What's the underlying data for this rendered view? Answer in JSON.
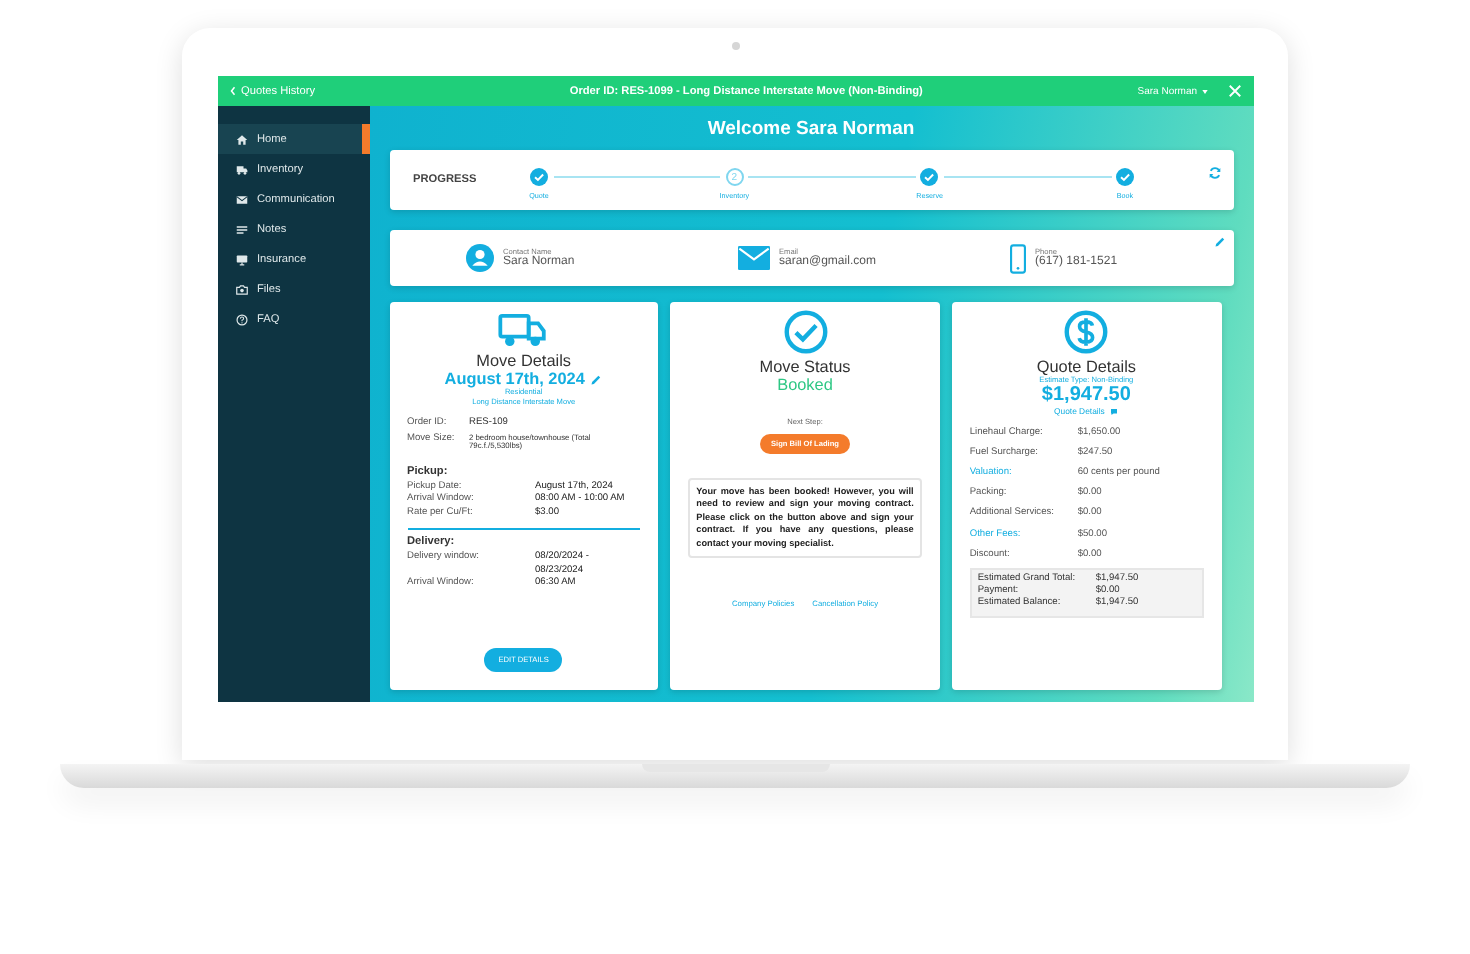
{
  "topbar": {
    "back_label": "Quotes History",
    "title": "Order ID: RES-1099 - Long Distance Interstate Move (Non-Binding)",
    "user": "Sara Norman"
  },
  "sidebar": {
    "items": [
      {
        "label": "Home",
        "selected": true
      },
      {
        "label": "Inventory",
        "selected": false
      },
      {
        "label": "Communication",
        "selected": false
      },
      {
        "label": "Notes",
        "selected": false
      },
      {
        "label": "Insurance",
        "selected": false
      },
      {
        "label": "Files",
        "selected": false
      },
      {
        "label": "FAQ",
        "selected": false
      }
    ]
  },
  "welcome": "Welcome Sara Norman",
  "progress": {
    "label": "PROGRESS",
    "steps": [
      {
        "label": "Quote",
        "done": true
      },
      {
        "label": "Inventory",
        "done": false,
        "number": "2"
      },
      {
        "label": "Reserve",
        "done": true
      },
      {
        "label": "Book",
        "done": true
      }
    ]
  },
  "contact": [
    {
      "label": "Contact Name",
      "value": "Sara Norman"
    },
    {
      "label": "Email",
      "value": "saran@gmail.com"
    },
    {
      "label": "Phone",
      "value": "(617) 181-1521"
    }
  ],
  "move_details": {
    "title": "Move Details",
    "date": "August 17th, 2024",
    "move_type": "Residential",
    "move_category": "Long Distance Interstate Move",
    "info": [
      {
        "label": "Order ID:",
        "value": "RES-109",
        "small": false
      },
      {
        "label": "Move Size:",
        "value": "2 bedroom house/townhouse (Total 79c.f./5,530lbs)",
        "small": true
      }
    ],
    "pickup": {
      "title": "Pickup:",
      "rows": [
        {
          "label": "Pickup Date:",
          "value": "August 17th, 2024"
        },
        {
          "label": "Arrival Window:",
          "value": "08:00 AM - 10:00 AM"
        },
        {
          "label": "Rate per Cu/Ft:",
          "value": "$3.00"
        }
      ]
    },
    "delivery": {
      "title": "Delivery:",
      "rows": [
        {
          "label": "Delivery window:",
          "value": "08/20/2024 - 08/23/2024"
        },
        {
          "label": "Arrival Window:",
          "value": "06:30 AM"
        }
      ]
    },
    "button": "EDIT DETAILS"
  },
  "move_status": {
    "title": "Move Status",
    "status": "Booked",
    "next_step_label": "Next Step:",
    "button": "Sign Bill Of Lading",
    "message": "Your move has been booked! However, you will need to review and sign your moving contract. Please click on the button above and sign your contract. If you have any questions, please contact your moving specialist.",
    "links": [
      "Company Policies",
      "Cancellation Policy"
    ]
  },
  "quote": {
    "title": "Quote Details",
    "estimate_type": "Estimate Type: Non-Binding",
    "total": "$1,947.50",
    "details_link": "Quote Details",
    "rows": [
      {
        "label": "Linehaul Charge:",
        "value": "$1,650.00",
        "link": false
      },
      {
        "label": "Fuel Surcharge:",
        "value": "$247.50",
        "link": false
      },
      {
        "label": "Valuation:",
        "value": "60 cents per pound",
        "link": true
      },
      {
        "label": "Packing:",
        "value": "$0.00",
        "link": false
      },
      {
        "label": "Additional Services:",
        "value": "$0.00",
        "link": false
      },
      {
        "label": "Other Fees:",
        "value": "$50.00",
        "link": true
      },
      {
        "label": "Discount:",
        "value": "$0.00",
        "link": false
      }
    ],
    "summary": [
      {
        "label": "Estimated Grand Total:",
        "value": "$1,947.50"
      },
      {
        "label": "Payment:",
        "value": "$0.00"
      },
      {
        "label": "Estimated Balance:",
        "value": "$1,947.50"
      }
    ]
  }
}
